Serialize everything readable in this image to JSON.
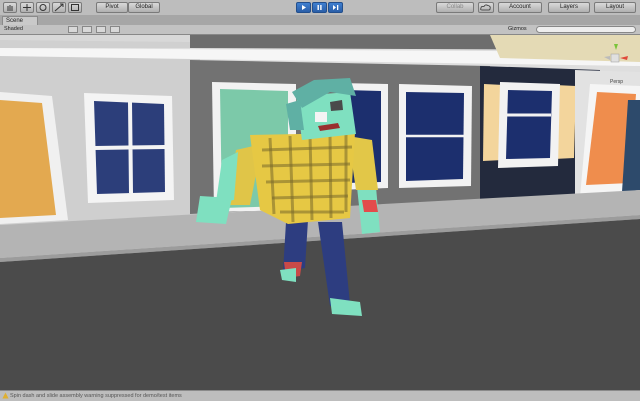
{
  "toolbar": {
    "pivot_label": "Pivot",
    "global_label": "Global",
    "collab_label": "Collab",
    "account_label": "Account",
    "layers_label": "Layers",
    "layout_label": "Layout"
  },
  "scene": {
    "tab_label": "Scene",
    "shading_mode": "Shaded",
    "gizmos_label": "Gizmos",
    "axis_label": "Persp"
  },
  "status": {
    "message": "Spin dash and slide assembly warning suppressed for demo/test items"
  },
  "colors": {
    "toolbar_bg": "#bdbdbd",
    "play_blue": "#2f6cc0",
    "road": "#4a4a4a",
    "sidewalk": "#b2b2b2",
    "sky": "#dcdcdc"
  }
}
